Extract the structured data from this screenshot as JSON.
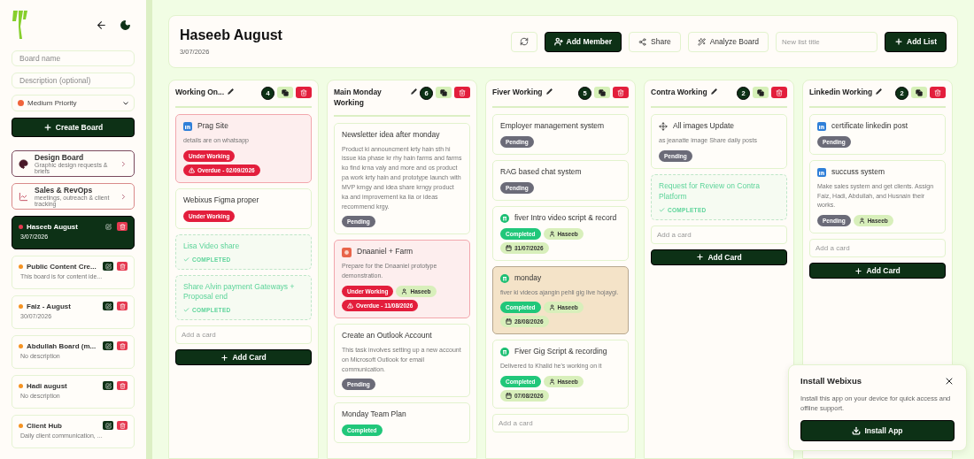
{
  "sidebar": {
    "form": {
      "name_placeholder": "Board name",
      "description_placeholder": "Description (optional)",
      "priority": {
        "label": "Medium Priority",
        "color": "#f0643c"
      },
      "create_label": "Create Board"
    },
    "templates": [
      {
        "kind": "design",
        "title": "Design Board",
        "subtitle": "Graphic design requests & briefs",
        "color": "#7a4a5e"
      },
      {
        "kind": "sales",
        "title": "Sales & RevOps",
        "subtitle": "meetings, outreach & client tracking",
        "color": "#d98a8a"
      }
    ],
    "boards": [
      {
        "title": "Haseeb August",
        "subtitle": "3/07/2026",
        "color": "#e53950",
        "selected": true
      },
      {
        "title": "Public Content Cre...",
        "subtitle": "This board is for content ide...",
        "color": "#f59322",
        "selected": false
      },
      {
        "title": "Faiz - August",
        "subtitle": "30/07/2026",
        "color": "#f59322",
        "selected": false
      },
      {
        "title": "Abdullah Board (m...",
        "subtitle": "No description",
        "color": "#f59322",
        "selected": false
      },
      {
        "title": "Hadi august",
        "subtitle": "No description",
        "color": "#f59322",
        "selected": false
      },
      {
        "title": "Client Hub",
        "subtitle": "Daily client communication, ...",
        "color": "#f59322",
        "selected": false
      }
    ]
  },
  "header": {
    "title": "Haseeb August",
    "date": "3/07/2026",
    "add_member": "Add Member",
    "share": "Share",
    "analyze": "Analyze Board",
    "list_placeholder": "New list title",
    "add_list": "Add List"
  },
  "columns": [
    {
      "title": "Working On...",
      "count": "4",
      "add_placeholder": "Add a card",
      "add_label": "Add Card",
      "cards": [
        {
          "kind": "overdue",
          "icon": {
            "kind": "linkedin"
          },
          "title": "Prag Site",
          "description": "details are on whatsapp",
          "tags": [
            {
              "kind": "danger",
              "label": "Under Working"
            },
            {
              "kind": "overdue",
              "label": "Overdue - 02/09/2026"
            }
          ]
        },
        {
          "kind": "normal",
          "title": "Webixus Figma proper",
          "tags": [
            {
              "kind": "danger",
              "label": "Under Working"
            }
          ]
        },
        {
          "kind": "completed",
          "title": "Lisa Video share",
          "status": "COMPLETED"
        },
        {
          "kind": "completed",
          "title": "Share Alvin payment Gateways + Proposal end",
          "status": "COMPLETED"
        }
      ]
    },
    {
      "title": "Main Monday Working",
      "count": "6",
      "cards": [
        {
          "kind": "normal",
          "title": "Newsletter idea after monday",
          "description": "Product ki announcment krty hain sth hi issue kia phase kr rhy hain farms and farms ko find krna valy and more and os product pa work krty hain and prototype launch with MVP krngy and idea share krngy product ka and improvement ka lia or ideas recommend krgy.",
          "tags": [
            {
              "kind": "pending",
              "label": "Pending"
            }
          ]
        },
        {
          "kind": "overdue",
          "icon": {
            "kind": "burst"
          },
          "title": "Dnaaniel + Farm",
          "description": "Prepare for the Dnaaniel prototype demonstration.",
          "tags": [
            {
              "kind": "danger",
              "label": "Under Working"
            },
            {
              "kind": "person",
              "label": "Haseeb"
            },
            {
              "kind": "overdue",
              "label": "Overdue - 11/08/2026"
            }
          ]
        },
        {
          "kind": "normal",
          "title": "Create an Outlook Account",
          "description": "This task involves setting up a new account on Microsoft Outlook for email communication.",
          "tags": [
            {
              "kind": "pending",
              "label": "Pending"
            }
          ]
        },
        {
          "kind": "normal",
          "title": "Monday Team Plan",
          "tags": [
            {
              "kind": "done",
              "label": "Completed"
            }
          ]
        }
      ]
    },
    {
      "title": "Fiver Working",
      "count": "5",
      "add_placeholder": "Add a card",
      "cards": [
        {
          "kind": "normal",
          "title": "Employer management system",
          "tags": [
            {
              "kind": "pending",
              "label": "Pending"
            }
          ]
        },
        {
          "kind": "normal",
          "title": "RAG based chat system",
          "tags": [
            {
              "kind": "pending",
              "label": "Pending"
            }
          ]
        },
        {
          "kind": "normal",
          "icon": {
            "kind": "fiverr"
          },
          "title": "fiver Intro video script & record",
          "tags": [
            {
              "kind": "done",
              "label": "Completed"
            },
            {
              "kind": "person",
              "label": "Haseeb"
            },
            {
              "kind": "date",
              "label": "31/07/2026"
            }
          ]
        },
        {
          "kind": "highlight",
          "icon": {
            "kind": "fiverr"
          },
          "title": "monday",
          "description": "fiver ki videos ajangin pehli gig live hojaygi.",
          "tags": [
            {
              "kind": "done",
              "label": "Completed"
            },
            {
              "kind": "person",
              "label": "Haseeb"
            },
            {
              "kind": "date",
              "label": "28/08/2026"
            }
          ]
        },
        {
          "kind": "normal",
          "icon": {
            "kind": "fiverr"
          },
          "title": "Fiver Gig Script & recording",
          "description": "Delivered to Khalid he's working on it",
          "tags": [
            {
              "kind": "done",
              "label": "Completed"
            },
            {
              "kind": "person",
              "label": "Haseeb"
            },
            {
              "kind": "date",
              "label": "07/08/2026"
            }
          ]
        }
      ]
    },
    {
      "title": "Contra Working",
      "count": "2",
      "add_placeholder": "Add a card",
      "add_label": "Add Card",
      "cards": [
        {
          "kind": "normal",
          "icon": {
            "kind": "move"
          },
          "title": "All images Update",
          "description": "as jeanatte image Share daily posts",
          "tags": [
            {
              "kind": "pending",
              "label": "Pending"
            }
          ]
        },
        {
          "kind": "completed",
          "title": "Request for Review on Contra Platform",
          "status": "COMPLETED"
        }
      ]
    },
    {
      "title": "Linkedin Working",
      "count": "2",
      "add_placeholder": "Add a card",
      "add_label": "Add Card",
      "cards": [
        {
          "kind": "normal",
          "icon": {
            "kind": "linkedin"
          },
          "title": "certificate linkedin post",
          "tags": [
            {
              "kind": "pending",
              "label": "Pending"
            }
          ]
        },
        {
          "kind": "normal",
          "icon": {
            "kind": "linkedin"
          },
          "title": "succuss system",
          "description": "Make sales system and get clients. Assign Faiz, Hadi, Abdullah, and Husnain their works.",
          "tags": [
            {
              "kind": "pending",
              "label": "Pending"
            },
            {
              "kind": "person",
              "label": "Haseeb"
            }
          ]
        }
      ]
    }
  ],
  "install_prompt": {
    "title": "Install Webixus",
    "text": "Install this app on your device for quick access and offline support.",
    "button": "Install App"
  }
}
